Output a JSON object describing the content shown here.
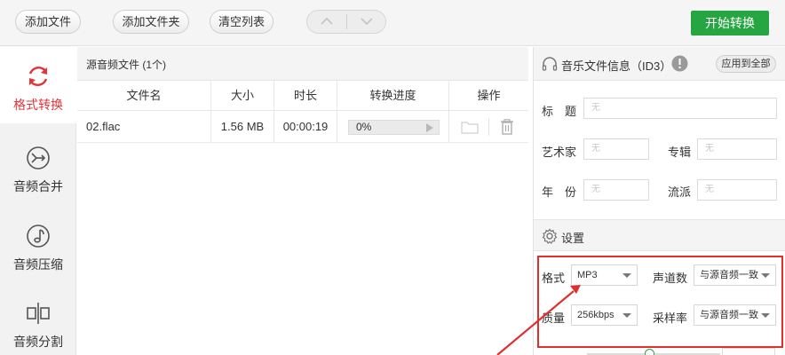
{
  "toolbar": {
    "add_file": "添加文件",
    "add_folder": "添加文件夹",
    "clear_list": "清空列表",
    "start_convert": "开始转换"
  },
  "sidebar": {
    "items": [
      {
        "label": "格式转换",
        "icon": "refresh-icon",
        "active": true
      },
      {
        "label": "音频合并",
        "icon": "merge-icon",
        "active": false
      },
      {
        "label": "音频压缩",
        "icon": "music-note-icon",
        "active": false
      },
      {
        "label": "音频分割",
        "icon": "split-icon",
        "active": false
      }
    ]
  },
  "file_list": {
    "header": "源音频文件 (1个)",
    "columns": [
      "文件名",
      "大小",
      "时长",
      "转换进度",
      "操作"
    ],
    "rows": [
      {
        "name": "02.flac",
        "size": "1.56 MB",
        "duration": "00:00:19",
        "progress": "0%"
      }
    ]
  },
  "id3": {
    "title": "音乐文件信息（ID3）",
    "apply_all": "应用到全部",
    "fields": {
      "title_label": "标　题",
      "artist_label": "艺术家",
      "album_label": "专辑",
      "year_label": "年　份",
      "genre_label": "流派",
      "placeholder": "无"
    }
  },
  "settings": {
    "title": "设置",
    "format_label": "格式",
    "format_value": "MP3",
    "channel_label": "声道数",
    "channel_value": "与源音频一致",
    "quality_label": "质量",
    "quality_value": "256kbps",
    "samplerate_label": "采样率",
    "samplerate_value": "与源音频一致"
  },
  "colors": {
    "accent_red": "#e1353a",
    "start_green": "#26a642",
    "highlight_box": "#e02f2f"
  }
}
